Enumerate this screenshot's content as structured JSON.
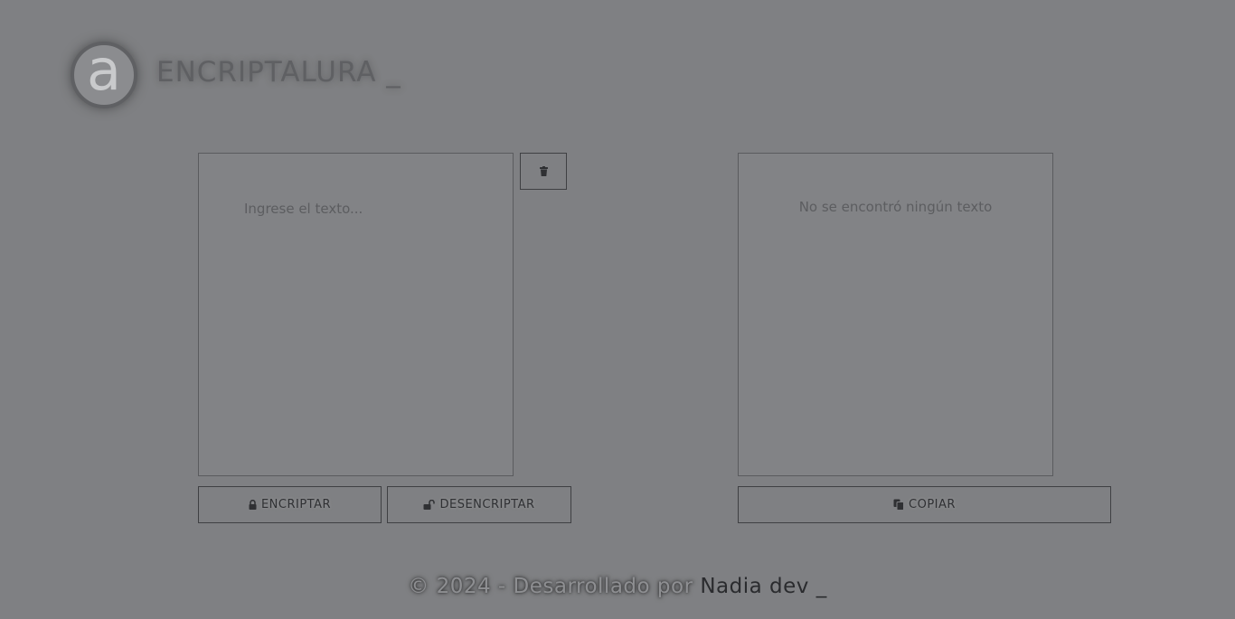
{
  "header": {
    "logo_letter": "a",
    "brand": "ENCRIPTALURA _"
  },
  "input_panel": {
    "placeholder": "Ingrese el texto..."
  },
  "output_panel": {
    "empty_message": "No se encontró ningún texto"
  },
  "buttons": {
    "clear_icon": "trash-icon",
    "encrypt_label": "ENCRIPTAR",
    "encrypt_icon": "lock-icon",
    "decrypt_label": "DESENCRIPTAR",
    "decrypt_icon": "unlock-icon",
    "copy_label": "COPIAR",
    "copy_icon": "copy-icon"
  },
  "footer": {
    "text": "© 2024 - Desarrollado por",
    "author": "Nadia dev _"
  },
  "colors": {
    "background": "#7f8083",
    "border": "#3f4043",
    "text_dark": "#2f3033"
  }
}
